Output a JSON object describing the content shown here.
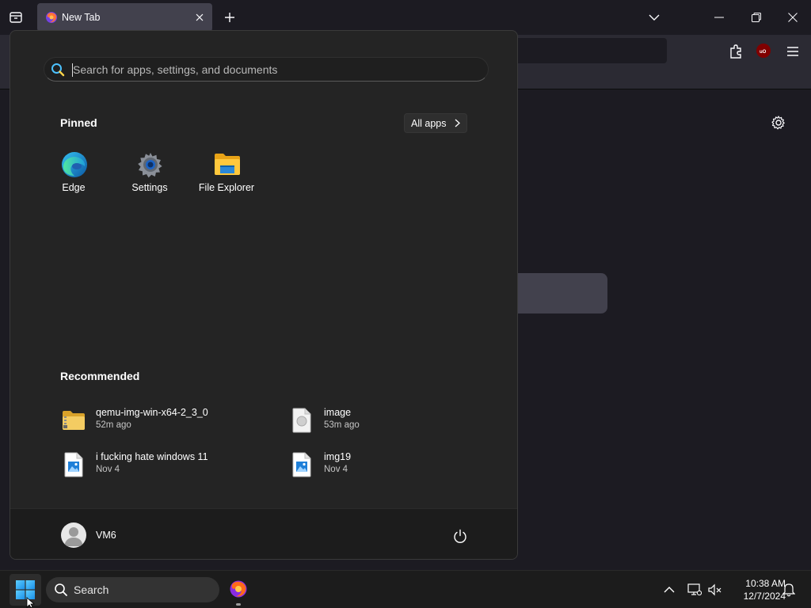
{
  "browser": {
    "tab_title": "New Tab"
  },
  "start_menu": {
    "search_placeholder": "Search for apps, settings, and documents",
    "pinned_title": "Pinned",
    "all_apps_label": "All apps",
    "pinned": [
      {
        "label": "Edge",
        "icon": "edge-icon"
      },
      {
        "label": "Settings",
        "icon": "settings-gear-icon"
      },
      {
        "label": "File Explorer",
        "icon": "folder-icon"
      }
    ],
    "recommended_title": "Recommended",
    "recommended": [
      {
        "name": "qemu-img-win-x64-2_3_0",
        "time": "52m ago",
        "icon": "zip-folder-icon"
      },
      {
        "name": "image",
        "time": "53m ago",
        "icon": "image-file-icon"
      },
      {
        "name": "i fucking hate windows 11",
        "time": "Nov 4",
        "icon": "picture-file-icon"
      },
      {
        "name": "img19",
        "time": "Nov 4",
        "icon": "picture-file-icon"
      }
    ],
    "user_name": "VM6"
  },
  "taskbar": {
    "search_label": "Search",
    "time": "10:38 AM",
    "date": "12/7/2024"
  },
  "colors": {
    "accent": "#0078d4",
    "start_bg": "#242424",
    "taskbar_bg": "#1c1c1c"
  }
}
